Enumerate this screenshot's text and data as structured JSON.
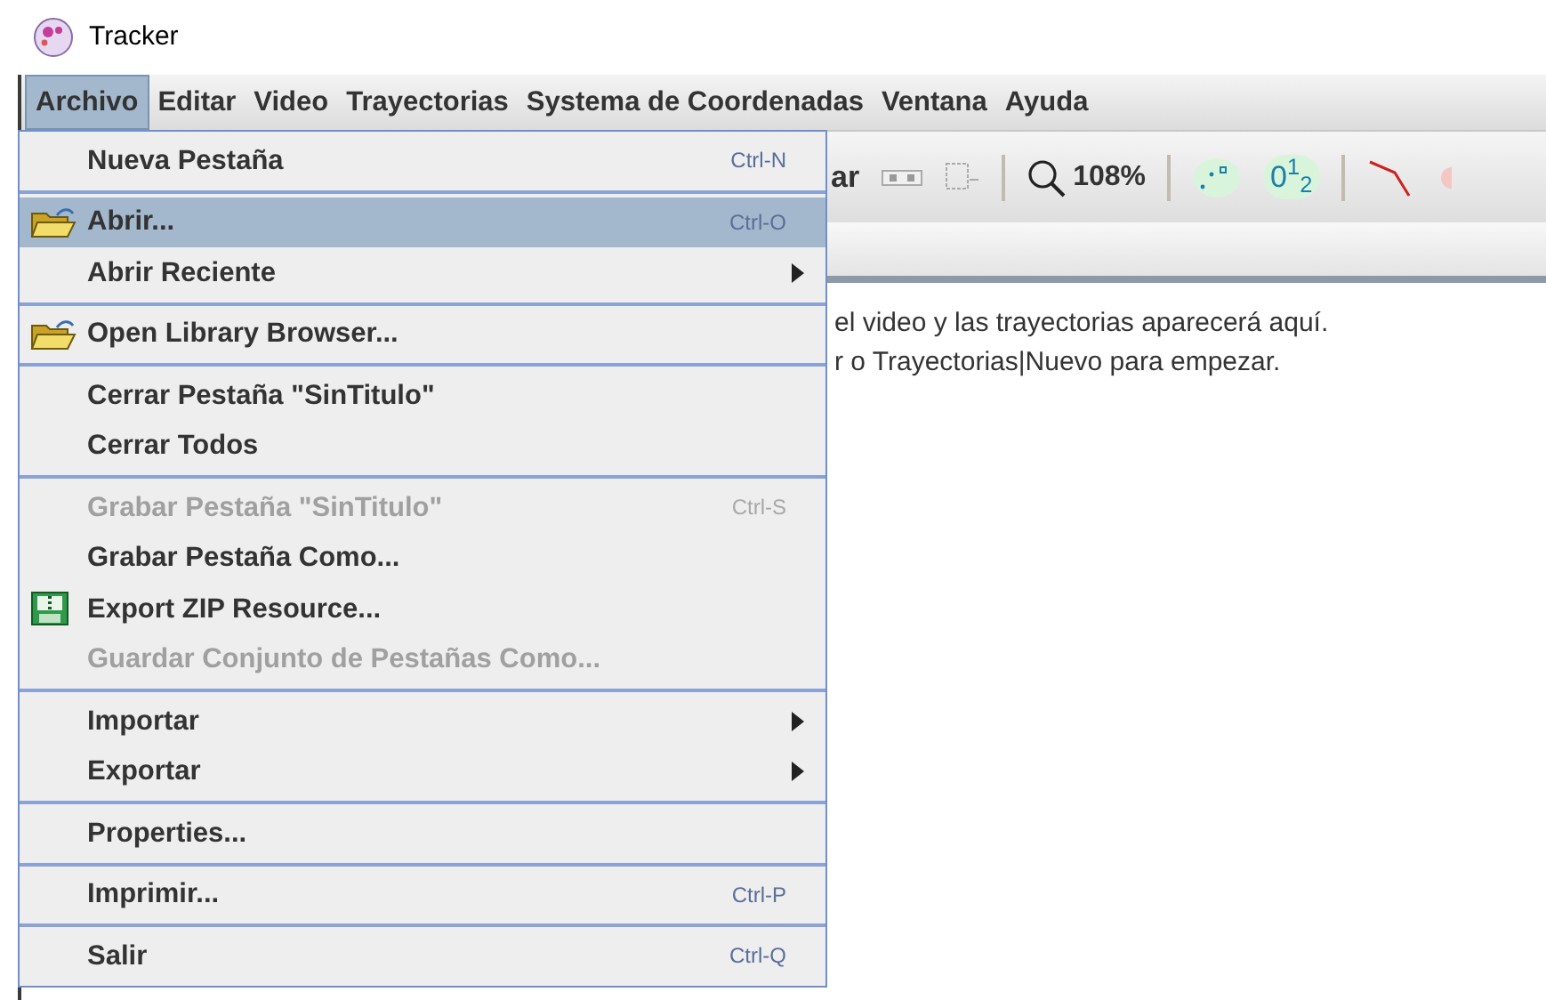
{
  "window": {
    "title": "Tracker"
  },
  "menu_bar": [
    {
      "label": "Archivo",
      "selected": true
    },
    {
      "label": "Editar",
      "selected": false
    },
    {
      "label": "Video",
      "selected": false
    },
    {
      "label": "Trayectorias",
      "selected": false
    },
    {
      "label": "Systema de Coordenadas",
      "selected": false
    },
    {
      "label": "Ventana",
      "selected": false
    },
    {
      "label": "Ayuda",
      "selected": false
    }
  ],
  "toolbar": {
    "cut_label": "ar",
    "zoom": "108%",
    "numbering": "0$^{1}$$_{2}$"
  },
  "message": [
    "el video y las trayectorias aparecerá aquí.",
    "r o Trayectorias|Nuevo para empezar."
  ],
  "menu": {
    "sections": [
      [
        {
          "kind": "plain",
          "label": "Nueva Pestaña",
          "shortcut": "Ctrl-N",
          "submenu": false,
          "disabled": false,
          "selected": false
        }
      ],
      [
        {
          "kind": "opener",
          "label": "Abrir...",
          "shortcut": "Ctrl-O",
          "submenu": false,
          "disabled": false,
          "selected": true
        },
        {
          "kind": "plain",
          "label": "Abrir Reciente",
          "submenu": true,
          "disabled": false,
          "selected": false
        }
      ],
      [
        {
          "kind": "opener",
          "label": "Open Library Browser...",
          "submenu": false,
          "disabled": false,
          "selected": false
        }
      ],
      [
        {
          "kind": "plain",
          "label": "Cerrar Pestaña \"SinTitulo\"",
          "submenu": false,
          "disabled": false,
          "selected": false
        },
        {
          "kind": "plain",
          "label": "Cerrar Todos",
          "submenu": false,
          "disabled": false,
          "selected": false
        }
      ],
      [
        {
          "kind": "plain",
          "label": "Grabar Pestaña \"SinTitulo\"",
          "shortcut": "Ctrl-S",
          "submenu": false,
          "disabled": true,
          "selected": false
        },
        {
          "kind": "plain",
          "label": "Grabar Pestaña Como...",
          "submenu": false,
          "disabled": false,
          "selected": false
        },
        {
          "kind": "archive",
          "label": "Export ZIP Resource...",
          "submenu": false,
          "disabled": false,
          "selected": false
        },
        {
          "kind": "plain",
          "label": "Guardar Conjunto de Pestañas Como...",
          "submenu": false,
          "disabled": true,
          "selected": false
        }
      ],
      [
        {
          "kind": "plain",
          "label": "Importar",
          "submenu": true,
          "disabled": false,
          "selected": false
        },
        {
          "kind": "plain",
          "label": "Exportar",
          "submenu": true,
          "disabled": false,
          "selected": false
        }
      ],
      [
        {
          "kind": "plain",
          "label": "Properties...",
          "submenu": false,
          "disabled": false,
          "selected": false
        }
      ],
      [
        {
          "kind": "plain",
          "label": "Imprimir...",
          "shortcut": "Ctrl-P",
          "submenu": false,
          "disabled": false,
          "selected": false
        }
      ],
      [
        {
          "kind": "plain",
          "label": "Salir",
          "shortcut": "Ctrl-Q",
          "submenu": false,
          "disabled": false,
          "selected": false
        }
      ]
    ]
  }
}
